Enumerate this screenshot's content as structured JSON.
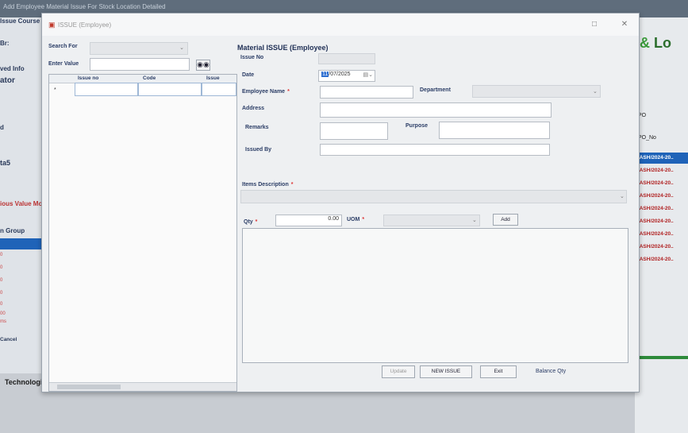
{
  "background": {
    "top_title": "Add Employee Material Issue For Stock Location Detailed",
    "left_texts": [
      "Issue Course",
      "Br:",
      "ved Info",
      "ator",
      "d",
      "ta5",
      "ious Value Mo",
      "n Group",
      "Cancel"
    ],
    "left_rows": [
      "0",
      "0",
      "0",
      "0",
      "0",
      "00",
      "00",
      "ms"
    ],
    "right_logo": "Lo",
    "right_po_header": "PO",
    "right_po_col": "PO_No",
    "po_list": [
      "YASH/2024-20..",
      "YASH/2024-20..",
      "YASH/2024-20..",
      "YASH/2024-20..",
      "YASH/2024-20..",
      "YASH/2024-20..",
      "YASH/2024-20..",
      "YASH/2024-20..",
      "YASH/2024-20.."
    ],
    "taskbar_text": "Technologi"
  },
  "window": {
    "title": "ISSUE (Employee)",
    "maximize_icon": "maximize-icon",
    "close_icon": "close-icon"
  },
  "search": {
    "search_for_label": "Search For",
    "enter_value_label": "Enter Value",
    "enter_value": "",
    "search_button_icon": "binoculars-icon"
  },
  "grid": {
    "columns": [
      "Issue no",
      "Code",
      "Issue"
    ],
    "row_marker": "*"
  },
  "form": {
    "heading": "Material ISSUE (Employee)",
    "issue_no_label": "Issue No",
    "issue_no": "",
    "date_label": "Date",
    "date_day": "11",
    "date_rest": "/07/2025",
    "employee_name_label": "Employee Name",
    "employee_name": "",
    "department_label": "Department",
    "department": "",
    "address_label": "Address",
    "address": "",
    "remarks_label": "Remarks",
    "remarks": "",
    "purpose_label": "Purpose",
    "purpose": "",
    "issued_by_label": "Issued By",
    "issued_by": "",
    "items_description_label": "Items Description",
    "items_description": "",
    "qty_label": "Qty",
    "qty": "0.00",
    "uom_label": "UOM",
    "uom": "",
    "add_button": "Add",
    "update_button": "Update",
    "new_issue_button": "NEW ISSUE",
    "exit_button": "Exit",
    "balance_qty_label": "Balance Qty"
  },
  "colors": {
    "accent": "#1f63b8",
    "required": "#d33333",
    "label": "#2b3d66"
  }
}
